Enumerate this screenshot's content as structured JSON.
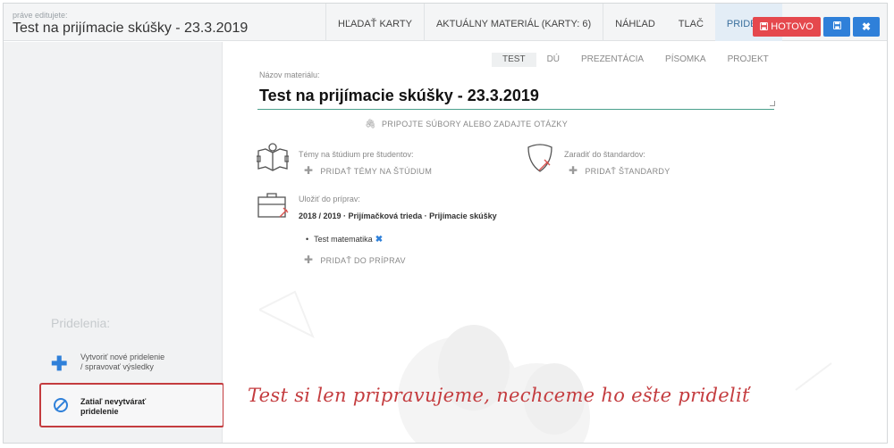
{
  "header": {
    "editing_label": "práve editujete:",
    "title": "Test na prijímacie skúšky - 23.3.2019",
    "nav": [
      {
        "label": "HĽADAŤ KARTY",
        "active": false
      },
      {
        "label": "AKTUÁLNY MATERIÁL (KARTY: 6)",
        "active": false
      },
      {
        "label": "NÁHĽAD",
        "active": false
      },
      {
        "label": "TLAČ",
        "active": false
      },
      {
        "label": "PRIDELIŤ",
        "active": true
      }
    ],
    "done_label": "HOTOVO",
    "done_icon": "save-icon",
    "save_icon": "save-icon",
    "close_icon": "close-icon",
    "colors": {
      "done": "#e5484d",
      "primary": "#2f80d9"
    }
  },
  "sidebar": {
    "heading": "Pridelenia:",
    "create_line1": "Vytvoriť nové pridelenie",
    "create_line2": "/ spravovať výsledky",
    "no_assign_line1": "Zatiaľ nevytvárať",
    "no_assign_line2": "pridelenie"
  },
  "main": {
    "type_tabs": [
      {
        "label": "TEST",
        "active": true
      },
      {
        "label": "DÚ",
        "active": false
      },
      {
        "label": "PREZENTÁCIA",
        "active": false
      },
      {
        "label": "PÍSOMKA",
        "active": false
      },
      {
        "label": "PROJEKT",
        "active": false
      }
    ],
    "name_label": "Názov materiálu:",
    "name_value": "Test na prijímacie skúšky - 23.3.2019",
    "attach_label": "PRIPOJTE SÚBORY ALEBO ZADAJTE OTÁZKY",
    "topics_label": "Témy na štúdium pre študentov:",
    "topics_add": "PRIDAŤ TÉMY NA ŠTÚDIUM",
    "standards_label": "Zaradiť do štandardov:",
    "standards_add": "PRIDAŤ ŠTANDARDY",
    "prep_label": "Uložiť do príprav:",
    "prep_path": "2018 / 2019 · Prijímačková trieda · Prijímacie skúšky",
    "prep_item": "Test matematika",
    "prep_add": "PRIDAŤ DO PRÍPRAV"
  },
  "annotation": "Test si len pripravujeme, nechceme ho ešte prideliť"
}
